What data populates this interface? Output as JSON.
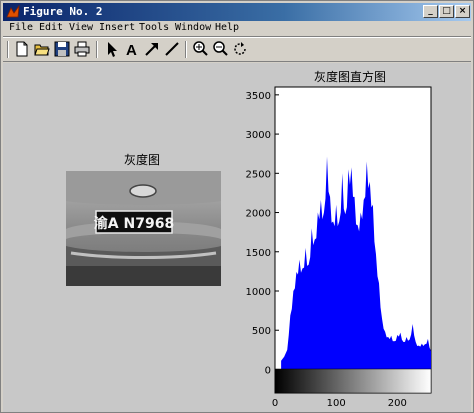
{
  "window": {
    "title": "Figure No. 2",
    "buttons": {
      "minimize": "_",
      "maximize": "□",
      "close": "×"
    }
  },
  "menu": [
    "File",
    "Edit",
    "View",
    "Insert",
    "Tools",
    "Window",
    "Help"
  ],
  "toolbar": [
    "new-file-icon",
    "open-folder-icon",
    "save-icon",
    "print-icon",
    "select-arrow-icon",
    "insert-text-icon",
    "insert-arrow-icon",
    "insert-line-icon",
    "zoom-in-icon",
    "zoom-out-icon",
    "rotate-icon"
  ],
  "image_panel": {
    "title": "灰度图",
    "plate_text": "渝A N7968"
  },
  "chart_data": {
    "type": "bar",
    "title": "灰度图直方图",
    "xlabel": "",
    "ylabel": "",
    "xlim": [
      0,
      255
    ],
    "ylim": [
      -300,
      3600
    ],
    "xticks": [
      0,
      100,
      200
    ],
    "yticks": [
      0,
      500,
      1000,
      1500,
      2000,
      2500,
      3000,
      3500
    ],
    "bar_color": "#0000ff",
    "colorbar": "gray",
    "x": [
      10,
      20,
      25,
      30,
      35,
      40,
      45,
      50,
      55,
      60,
      65,
      70,
      75,
      80,
      85,
      90,
      95,
      100,
      105,
      110,
      115,
      120,
      125,
      130,
      135,
      140,
      145,
      150,
      155,
      160,
      165,
      170,
      175,
      180,
      185,
      190,
      195,
      200,
      205,
      210,
      215,
      220,
      225,
      230,
      235,
      240,
      245,
      250,
      255
    ],
    "values": [
      120,
      250,
      750,
      1000,
      1350,
      1400,
      1400,
      1550,
      1450,
      1800,
      1800,
      2000,
      2350,
      2000,
      2950,
      2200,
      2050,
      2100,
      2050,
      2500,
      2150,
      2550,
      2800,
      2200,
      2000,
      2000,
      2350,
      2650,
      2600,
      2100,
      1600,
      1100,
      700,
      480,
      450,
      430,
      390,
      440,
      510,
      350,
      450,
      380,
      630,
      350,
      330,
      330,
      350,
      390,
      250
    ]
  }
}
